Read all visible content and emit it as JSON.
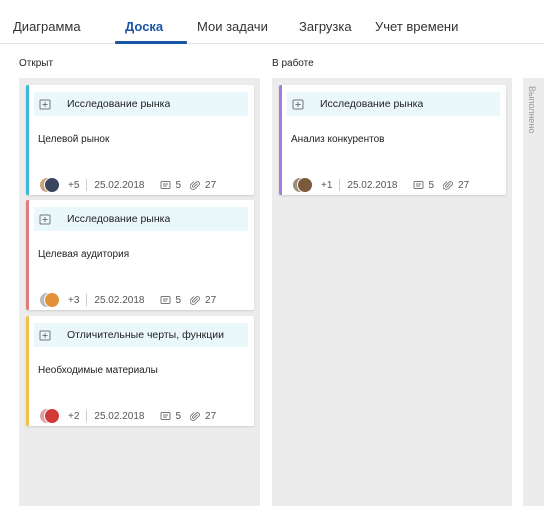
{
  "tabs": [
    {
      "label": "Диаграмма"
    },
    {
      "label": "Доска",
      "active": true
    },
    {
      "label": "Мои задачи"
    },
    {
      "label": "Загрузка"
    },
    {
      "label": "Учет времени"
    }
  ],
  "columns": {
    "open": {
      "title": "Открыт"
    },
    "in_progress": {
      "title": "В работе"
    },
    "done": {
      "title": "Выполнено"
    }
  },
  "cards": [
    {
      "header": "Исследование рынка",
      "task": "Целевой рынок",
      "extra": "+5",
      "date": "25.02.2018",
      "comments": "5",
      "attachments": "27",
      "stripe_color": "#3db8d4",
      "header_bg": "#eaf7fb"
    },
    {
      "header": "Исследование рынка",
      "task": "Целевая аудитория",
      "extra": "+3",
      "date": "25.02.2018",
      "comments": "5",
      "attachments": "27",
      "stripe_color": "#e07b7b",
      "header_bg": "#eaf7fb"
    },
    {
      "header": "Отличительные черты, функции",
      "task": "Необходимые материалы",
      "extra": "+2",
      "date": "25.02.2018",
      "comments": "5",
      "attachments": "27",
      "stripe_color": "#f0c04a",
      "header_bg": "#eaf7fb"
    },
    {
      "header": "Исследование рынка",
      "task": "Анализ конкурентов",
      "extra": "+1",
      "date": "25.02.2018",
      "comments": "5",
      "attachments": "27",
      "stripe_color": "#a77bd9",
      "header_bg": "#eaf7fb"
    }
  ],
  "colors": {
    "accent": "#1a56a8",
    "column_bg": "#ececec"
  },
  "icons": {
    "card_head": "plus-square-icon",
    "comments": "comment-icon",
    "attachments": "paperclip-icon"
  }
}
